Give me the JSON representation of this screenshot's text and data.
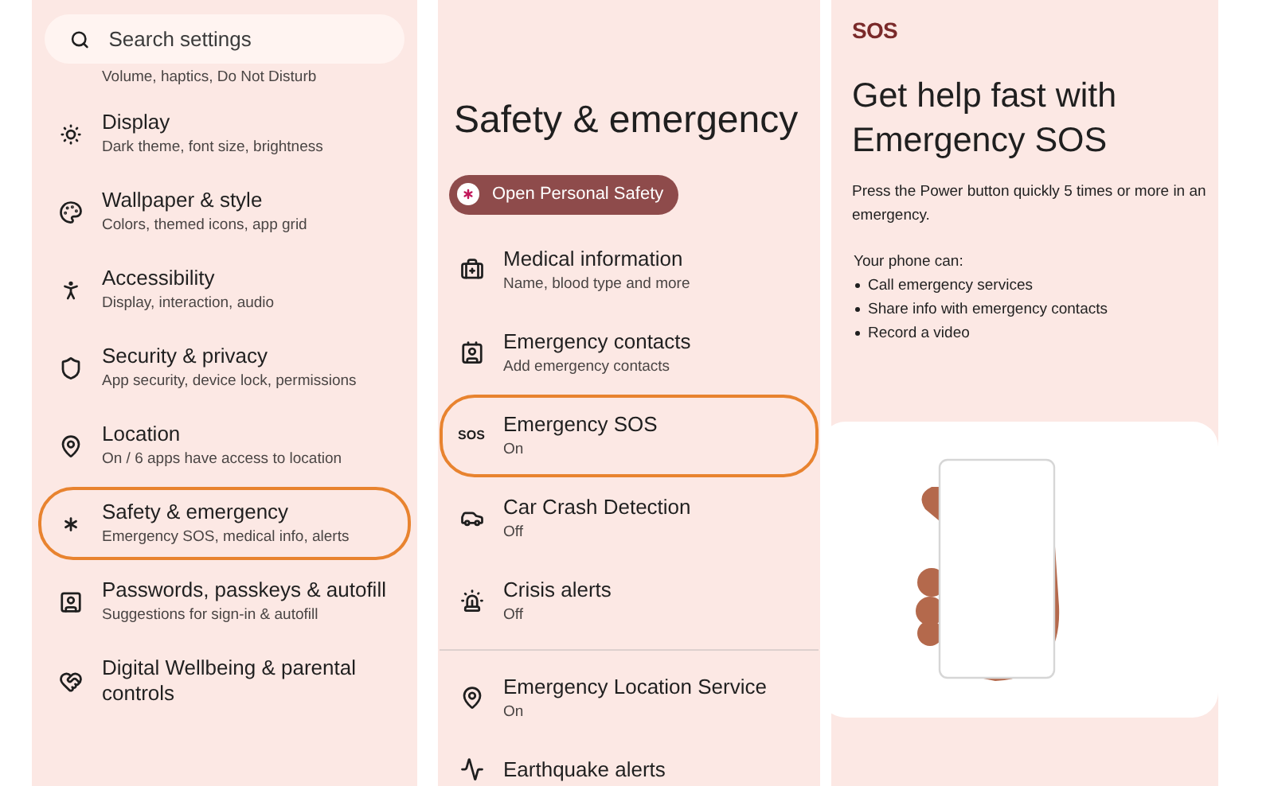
{
  "settings_panel": {
    "search": {
      "placeholder": "Search settings"
    },
    "clipped_subtitle": "Volume, haptics, Do Not Disturb",
    "items": [
      {
        "title": "Display",
        "subtitle": "Dark theme, font size, brightness",
        "highlighted": false
      },
      {
        "title": "Wallpaper & style",
        "subtitle": "Colors, themed icons, app grid",
        "highlighted": false
      },
      {
        "title": "Accessibility",
        "subtitle": "Display, interaction, audio",
        "highlighted": false
      },
      {
        "title": "Security & privacy",
        "subtitle": "App security, device lock, permissions",
        "highlighted": false
      },
      {
        "title": "Location",
        "subtitle": "On / 6 apps have access to location",
        "highlighted": false
      },
      {
        "title": "Safety & emergency",
        "subtitle": "Emergency SOS, medical info, alerts",
        "highlighted": true
      },
      {
        "title": "Passwords, passkeys & autofill",
        "subtitle": "Suggestions for sign-in & autofill",
        "highlighted": false
      },
      {
        "title": "Digital Wellbeing & parental controls",
        "highlighted": false
      }
    ]
  },
  "safety_panel": {
    "title": "Safety & emergency",
    "chip": "Open Personal Safety",
    "items": [
      {
        "title": "Medical information",
        "subtitle": "Name, blood type and more",
        "highlighted": false
      },
      {
        "title": "Emergency contacts",
        "subtitle": "Add emergency contacts",
        "highlighted": false
      },
      {
        "title": "Emergency SOS",
        "subtitle": "On",
        "icon_text": "SOS",
        "highlighted": true
      },
      {
        "title": "Car Crash Detection",
        "subtitle": "Off",
        "highlighted": false
      },
      {
        "title": "Crisis alerts",
        "subtitle": "Off",
        "highlighted": false,
        "divider_after": true
      },
      {
        "title": "Emergency Location Service",
        "subtitle": "On",
        "highlighted": false
      },
      {
        "title": "Earthquake alerts",
        "highlighted": false
      }
    ]
  },
  "sos_panel": {
    "logo": "SOS",
    "title": "Get help fast with Emergency SOS",
    "description": "Press the Power button quickly 5 times or more in an emergency.",
    "list_heading": "Your phone can:",
    "bullets": [
      "Call emergency services",
      "Share info with emergency contacts",
      "Record a video"
    ]
  }
}
